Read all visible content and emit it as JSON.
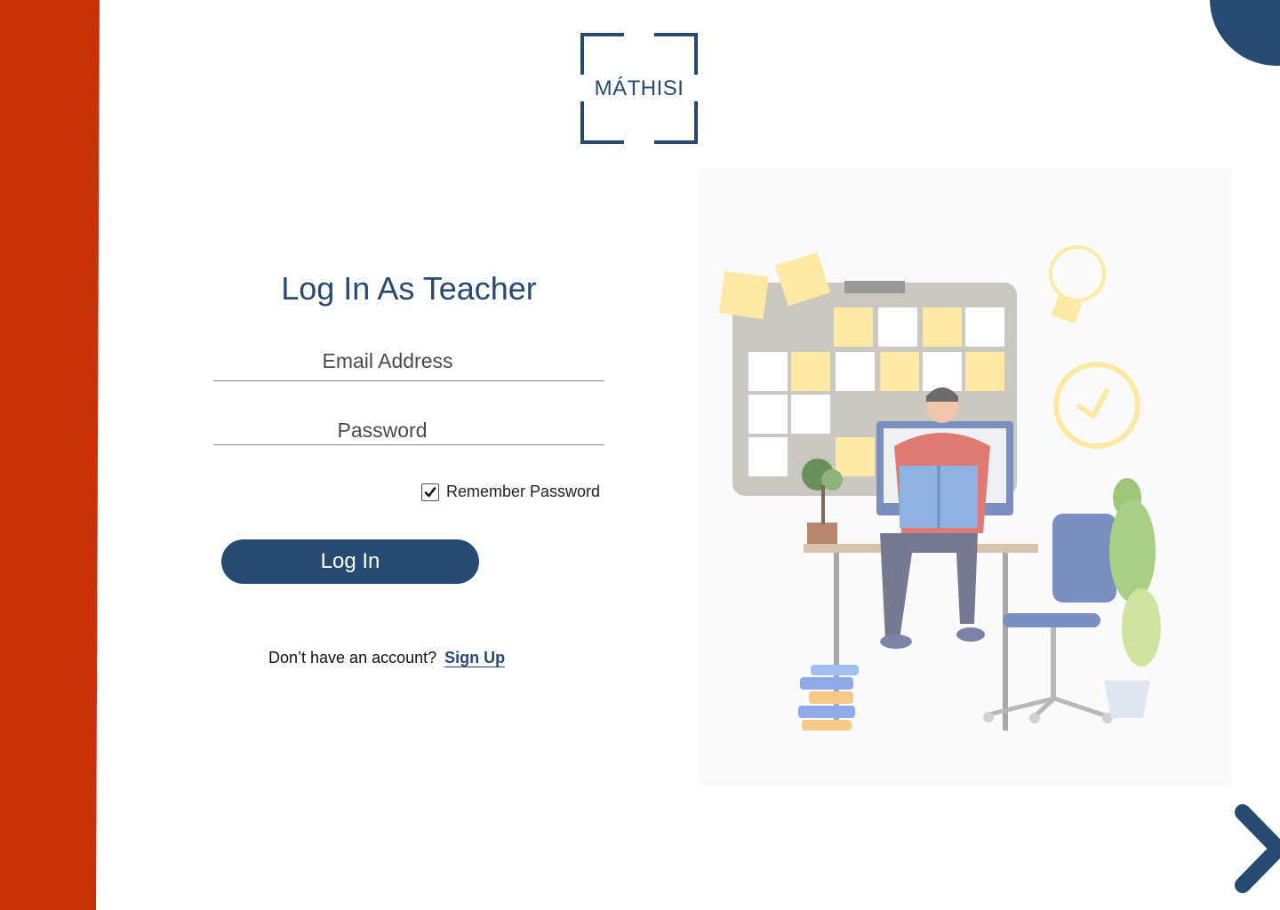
{
  "brand": {
    "logo_text": "MÁTHISI"
  },
  "login_form": {
    "title": "Log In As Teacher",
    "email_placeholder": "Email Address",
    "password_placeholder": "Password",
    "remember_label": "Remember Password",
    "remember_checked": true,
    "login_label": "Log In",
    "signup_prompt": "Don’t have an account?",
    "signup_link": "Sign Up"
  },
  "colors": {
    "accent_navy": "#264a70",
    "stripe_red": "#c73208",
    "background": "#ffffff"
  },
  "icons": {
    "checkbox": "check-icon",
    "next": "chevron-right-icon"
  }
}
